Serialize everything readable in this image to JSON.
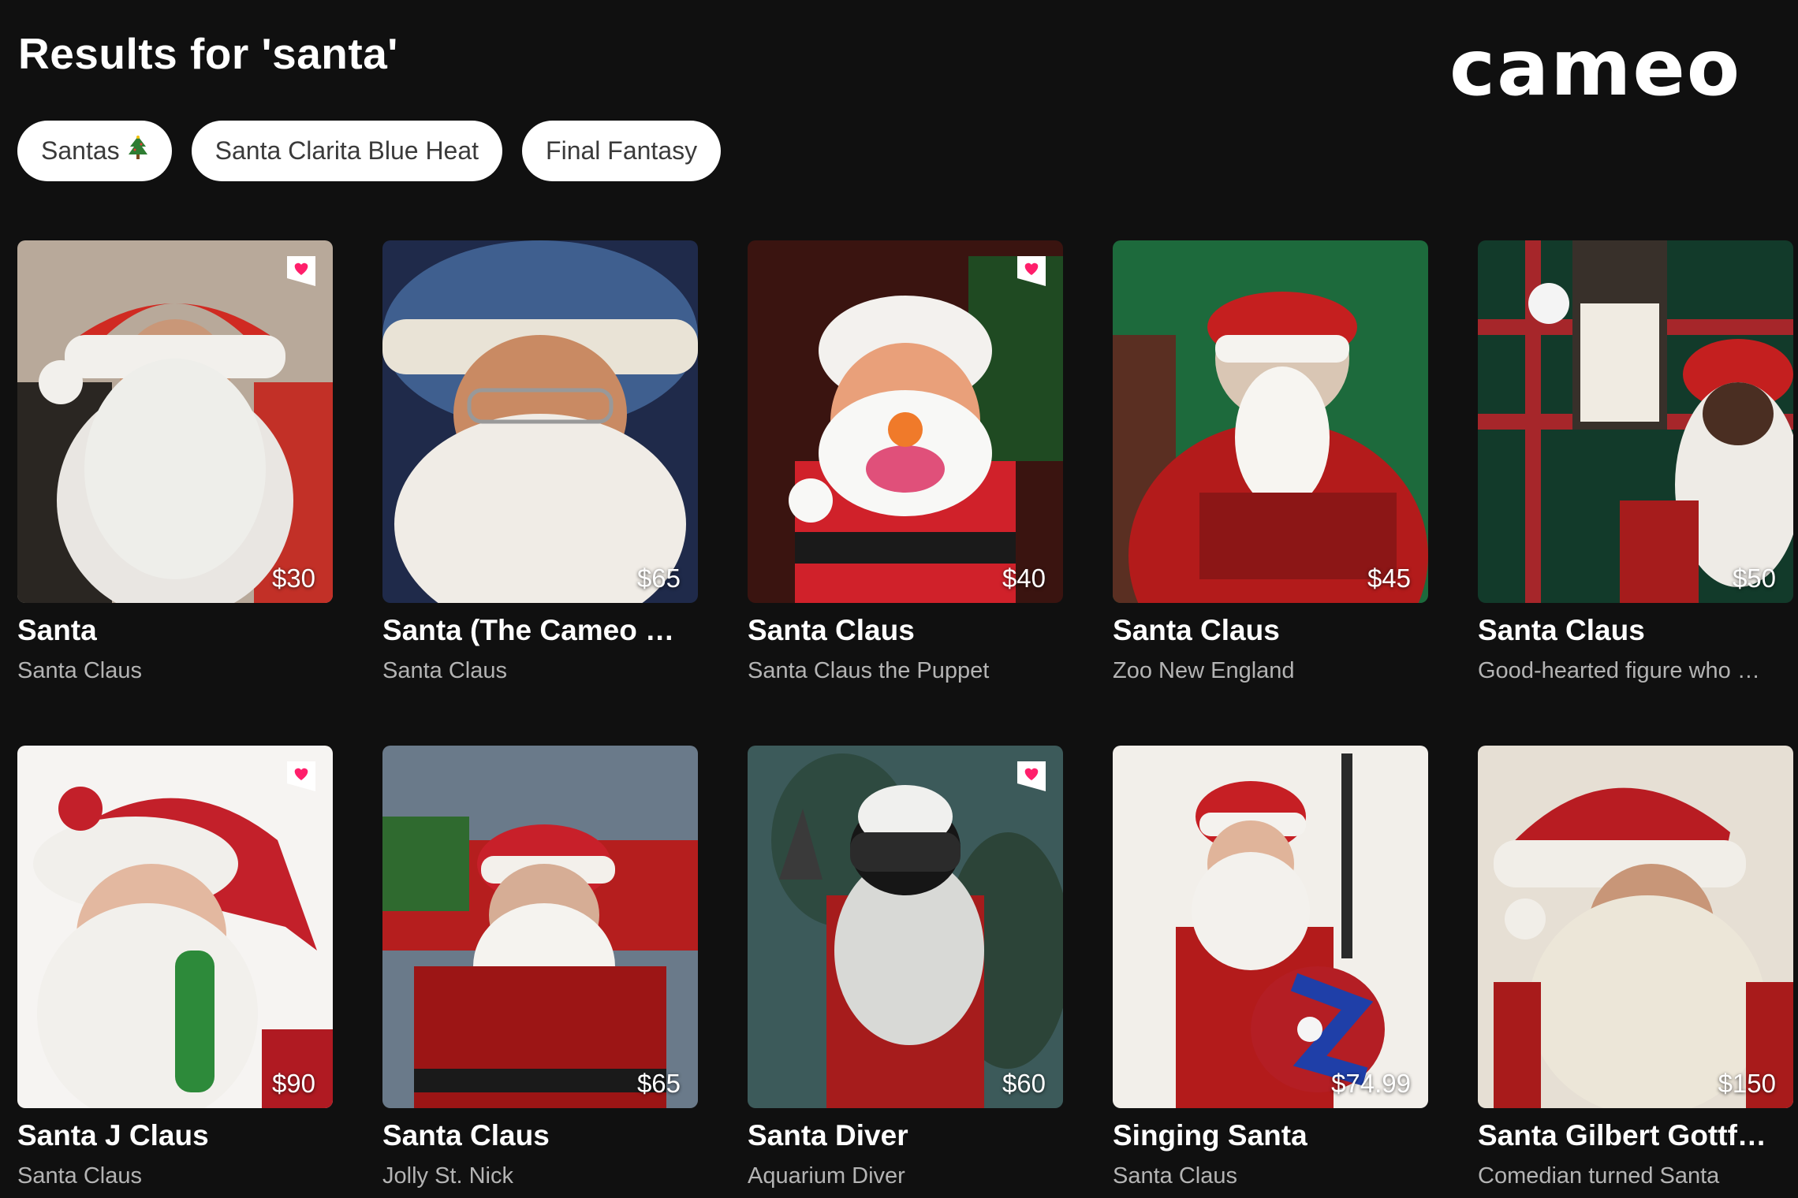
{
  "header": {
    "title": "Results for 'santa'",
    "logo": "cameo"
  },
  "chips": [
    {
      "label": "Santas",
      "icon": "christmas-tree-icon"
    },
    {
      "label": "Santa Clarita Blue Heat"
    },
    {
      "label": "Final Fantasy"
    }
  ],
  "cards": [
    {
      "name": "Santa",
      "subtitle": "Santa Claus",
      "price": "$30",
      "favorited": true
    },
    {
      "name": "Santa (The Cameo …",
      "subtitle": "Santa Claus",
      "price": "$65",
      "favorited": false
    },
    {
      "name": "Santa Claus",
      "subtitle": "Santa Claus the Puppet",
      "price": "$40",
      "favorited": true
    },
    {
      "name": "Santa Claus",
      "subtitle": "Zoo New England",
      "price": "$45",
      "favorited": false
    },
    {
      "name": "Santa Claus",
      "subtitle": "Good-hearted figure who …",
      "price": "$50",
      "favorited": false
    },
    {
      "name": "Santa J Claus",
      "subtitle": "Santa Claus",
      "price": "$90",
      "favorited": true
    },
    {
      "name": "Santa Claus",
      "subtitle": "Jolly St. Nick",
      "price": "$65",
      "favorited": false
    },
    {
      "name": "Santa Diver",
      "subtitle": "Aquarium Diver",
      "price": "$60",
      "favorited": true
    },
    {
      "name": "Singing Santa",
      "subtitle": "Santa Claus",
      "price": "$74.99",
      "favorited": false
    },
    {
      "name": "Santa Gilbert Gottf…",
      "subtitle": "Comedian turned Santa",
      "price": "$150",
      "favorited": false
    }
  ],
  "colors": {
    "background": "#101010",
    "chip_bg": "#ffffff",
    "heart": "#ff1f6b",
    "subtitle": "#b4b4b4"
  }
}
